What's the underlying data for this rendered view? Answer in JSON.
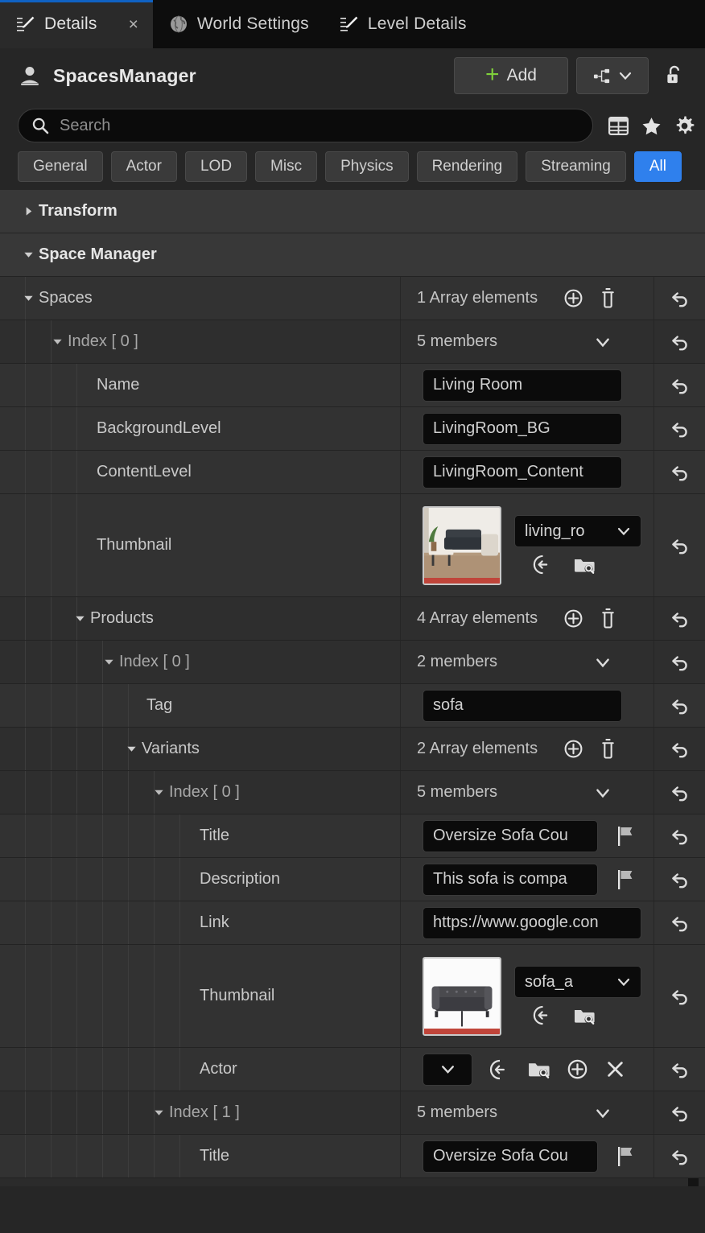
{
  "tabs": [
    {
      "label": "Details",
      "icon": "details-pencil-icon",
      "active": true,
      "closable": true,
      "close": "×"
    },
    {
      "label": "World Settings",
      "icon": "globe-icon",
      "active": false,
      "closable": false
    },
    {
      "label": "Level Details",
      "icon": "details-pencil-icon",
      "active": false,
      "closable": false
    }
  ],
  "header": {
    "actor_name": "SpacesManager",
    "actor_icon": "actor-pawn-icon",
    "add_label": "Add",
    "add_plus": "+",
    "blueprint_icon": "blueprint-hierarchy-icon",
    "blueprint_caret": "chevron-down-icon",
    "lock_icon": "unlock-icon"
  },
  "search": {
    "placeholder": "Search",
    "icon": "search-icon"
  },
  "toolbar_icons": [
    {
      "name": "column-layout-icon"
    },
    {
      "name": "favorites-star-icon"
    },
    {
      "name": "settings-gear-icon"
    }
  ],
  "filters": [
    {
      "label": "General",
      "active": false
    },
    {
      "label": "Actor",
      "active": false
    },
    {
      "label": "LOD",
      "active": false
    },
    {
      "label": "Misc",
      "active": false
    },
    {
      "label": "Physics",
      "active": false
    },
    {
      "label": "Rendering",
      "active": false
    },
    {
      "label": "Streaming",
      "active": false
    },
    {
      "label": "All",
      "active": true
    }
  ],
  "rows": {
    "transform": {
      "label": "Transform"
    },
    "space_manager": {
      "label": "Space Manager"
    },
    "spaces": {
      "label": "Spaces",
      "value": "1 Array elements"
    },
    "space_index0": {
      "label": "Index [ 0 ]",
      "value": "5 members"
    },
    "name": {
      "label": "Name",
      "value": "Living Room"
    },
    "background_level": {
      "label": "BackgroundLevel",
      "value": "LivingRoom_BG"
    },
    "content_level": {
      "label": "ContentLevel",
      "value": "LivingRoom_Content"
    },
    "space_thumbnail": {
      "label": "Thumbnail",
      "asset": "living_ro",
      "thumb_alt": "living-room-photo"
    },
    "products": {
      "label": "Products",
      "value": "4 Array elements"
    },
    "product_index0": {
      "label": "Index [ 0 ]",
      "value": "2 members"
    },
    "tag": {
      "label": "Tag",
      "value": "sofa"
    },
    "variants": {
      "label": "Variants",
      "value": "2 Array elements"
    },
    "variant_index0": {
      "label": "Index [ 0 ]",
      "value": "5 members"
    },
    "title0": {
      "label": "Title",
      "value": "Oversize Sofa Cou"
    },
    "description0": {
      "label": "Description",
      "value": "This sofa is compa"
    },
    "link0": {
      "label": "Link",
      "value": "https://www.google.con"
    },
    "variant_thumbnail": {
      "label": "Thumbnail",
      "asset": "sofa_a",
      "thumb_alt": "grey-sofa-photo"
    },
    "actor": {
      "label": "Actor"
    },
    "variant_index1": {
      "label": "Index [ 1 ]",
      "value": "5 members"
    },
    "title1": {
      "label": "Title",
      "value": "Oversize Sofa Cou"
    }
  },
  "icons": {
    "expand_collapsed": "chevron-right-triangle-icon",
    "expand_open": "chevron-down-triangle-icon",
    "array_add": "array-add-icon",
    "array_delete": "array-delete-trash-icon",
    "reset": "reset-arrow-icon",
    "members_caret": "chevron-down-icon",
    "localize_flag": "localization-flag-icon",
    "browse_back": "use-selected-asset-icon",
    "browse_content": "browse-to-asset-icon",
    "add_component": "add-circle-icon",
    "clear": "clear-x-icon"
  },
  "colors": {
    "accent_blue": "#2f80ed",
    "tab_active_bar": "#0f62c4",
    "add_plus_green": "#7fd13b",
    "panel_bg": "#2b2b2b",
    "row_bg": "#323232",
    "field_bg": "#0b0b0b"
  }
}
